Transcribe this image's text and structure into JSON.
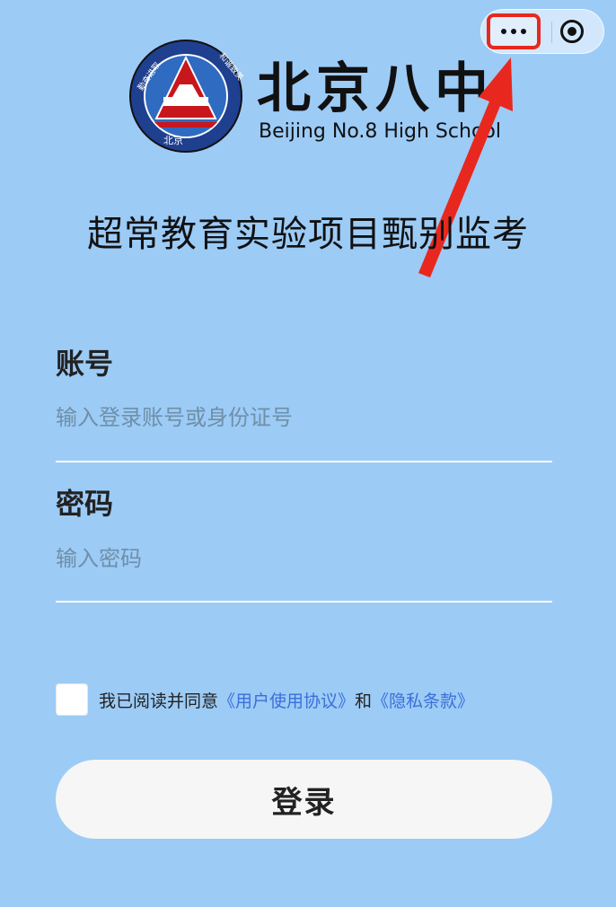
{
  "capsule": {
    "more_icon": "more-dots-icon",
    "close_icon": "target-close-icon"
  },
  "logo": {
    "name_cn": "北京八中",
    "name_en": "Beijing No.8 High School",
    "emblem_text_left": "勤奋进取",
    "emblem_text_right": "和谐致美",
    "emblem_text_bottom": "北京"
  },
  "project_title": "超常教育实验项目甄别监考",
  "account": {
    "label": "账号",
    "placeholder": "输入登录账号或身份证号",
    "value": ""
  },
  "password": {
    "label": "密码",
    "placeholder": "输入密码",
    "value": ""
  },
  "agreement": {
    "prefix": "我已阅读并同意",
    "user_agreement": "《用户使用协议》",
    "and": "和",
    "privacy": "《隐私条款》",
    "checked": false
  },
  "login_button": "登录",
  "colors": {
    "background": "#9ccbf6",
    "annotation": "#e8281e",
    "link": "#3b6fd8"
  }
}
